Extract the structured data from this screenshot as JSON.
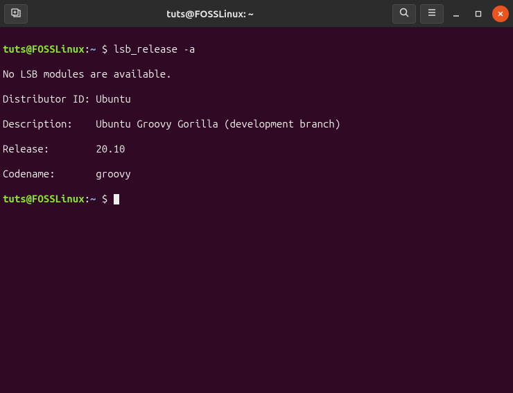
{
  "titlebar": {
    "title": "tuts@FOSSLinux: ~"
  },
  "icons": {
    "newtab": "new-tab-icon",
    "search": "search-icon",
    "menu": "hamburger-icon",
    "minimize": "minimize-icon",
    "maximize": "maximize-icon",
    "close": "close-icon"
  },
  "terminal": {
    "prompt_user": "tuts@FOSSLinux",
    "prompt_sep": ":",
    "prompt_path": "~",
    "prompt_char": "$",
    "command": "lsb_release -a",
    "output": {
      "line1": "No LSB modules are available.",
      "line2_label": "Distributor ID:",
      "line2_value": "Ubuntu",
      "line3_label": "Description:",
      "line3_value": "Ubuntu Groovy Gorilla (development branch)",
      "line4_label": "Release:",
      "line4_value": "20.10",
      "line5_label": "Codename:",
      "line5_value": "groovy"
    }
  }
}
